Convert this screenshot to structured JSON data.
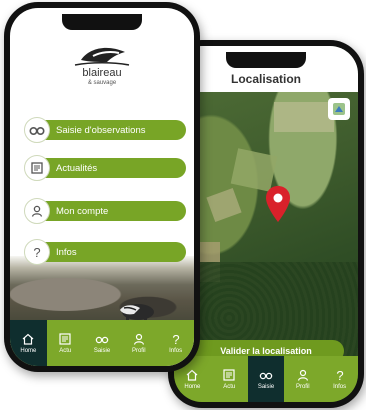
{
  "map_screen": {
    "title": "Localisation",
    "validate_label": "Valider la localisation",
    "nav": [
      {
        "label": "Home",
        "icon": "home-icon"
      },
      {
        "label": "Actu",
        "icon": "news-icon"
      },
      {
        "label": "Saisie",
        "icon": "binoculars-icon"
      },
      {
        "label": "Profil",
        "icon": "user-icon"
      },
      {
        "label": "Infos",
        "icon": "question-icon"
      }
    ],
    "active_nav": "Saisie"
  },
  "menu_screen": {
    "logo": {
      "name": "blaireau",
      "sub": "& sauvage"
    },
    "buttons": [
      {
        "label": "Saisie d'observations",
        "icon": "binoculars-icon"
      },
      {
        "label": "Actualités",
        "icon": "news-icon"
      },
      {
        "label": "Mon compte",
        "icon": "user-icon"
      },
      {
        "label": "Infos",
        "icon": "question-icon"
      }
    ],
    "nav": [
      {
        "label": "Home",
        "icon": "home-icon"
      },
      {
        "label": "Actu",
        "icon": "news-icon"
      },
      {
        "label": "Saisie",
        "icon": "binoculars-icon"
      },
      {
        "label": "Profil",
        "icon": "user-icon"
      },
      {
        "label": "Infos",
        "icon": "question-icon"
      }
    ],
    "active_nav": "Home"
  },
  "colors": {
    "accent": "#78a526",
    "nav_active": "#0f2e2e",
    "pin": "#d9212a"
  }
}
